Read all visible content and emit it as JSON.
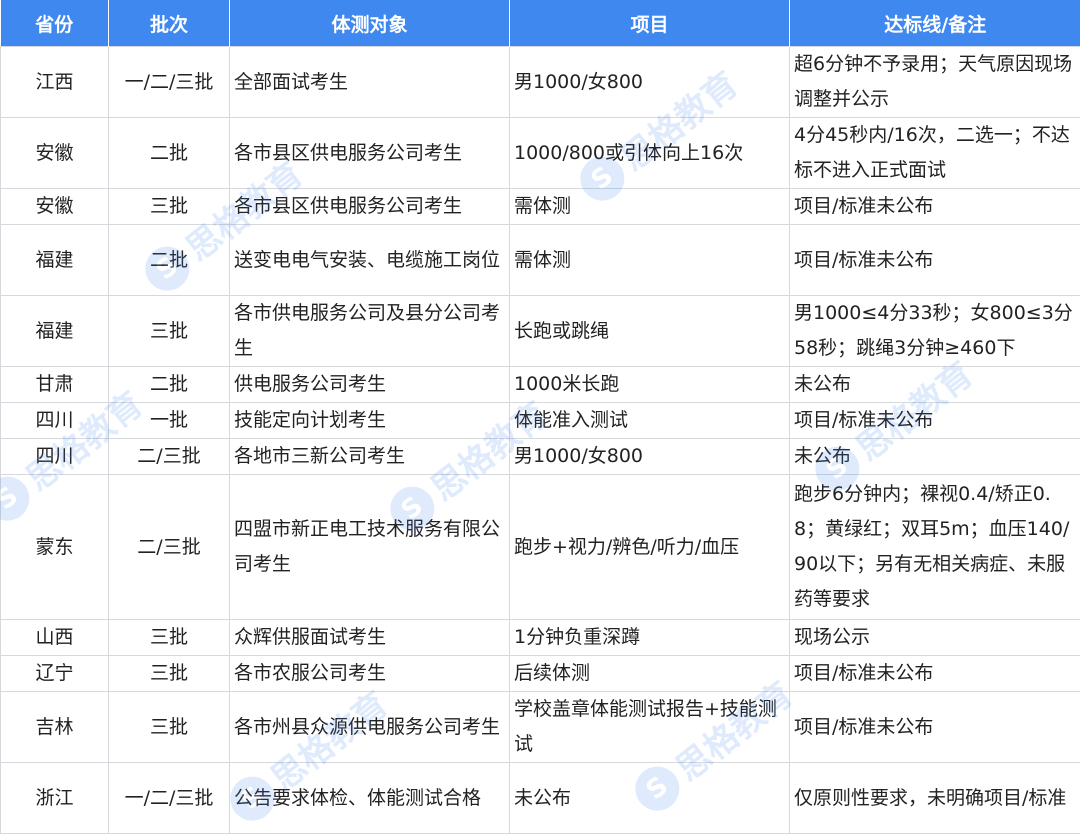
{
  "headers": [
    "省份",
    "批次",
    "体测对象",
    "项目",
    "达标线/备注"
  ],
  "rows": [
    {
      "province": "江西",
      "batch": "一/二/三批",
      "target": "全部面试考生",
      "item": "男1000/女800",
      "standard": "超6分钟不予录用；天气原因现场调整并公示"
    },
    {
      "province": "安徽",
      "batch": "二批",
      "target": "各市县区供电服务公司考生",
      "item": "1000/800或引体向上16次",
      "standard": "4分45秒内/16次，二选一；不达标不进入正式面试"
    },
    {
      "province": "安徽",
      "batch": "三批",
      "target": "各市县区供电服务公司考生",
      "item": "需体测",
      "standard": "项目/标准未公布"
    },
    {
      "province": "福建",
      "batch": "二批",
      "target": "送变电电气安装、电缆施工岗位",
      "item": "需体测",
      "standard": "项目/标准未公布"
    },
    {
      "province": "福建",
      "batch": "三批",
      "target": "各市供电服务公司及县分公司考生",
      "item": "长跑或跳绳",
      "standard": "男1000≤4分33秒；女800≤3分58秒；跳绳3分钟≥460下"
    },
    {
      "province": "甘肃",
      "batch": "二批",
      "target": "供电服务公司考生",
      "item": "1000米长跑",
      "standard": "未公布"
    },
    {
      "province": "四川",
      "batch": "一批",
      "target": "技能定向计划考生",
      "item": "体能准入测试",
      "standard": "项目/标准未公布"
    },
    {
      "province": "四川",
      "batch": "二/三批",
      "target": "各地市三新公司考生",
      "item": "男1000/女800",
      "standard": "未公布"
    },
    {
      "province": "蒙东",
      "batch": "二/三批",
      "target": "四盟市新正电工技术服务有限公司考生",
      "item": "跑步+视力/辨色/听力/血压",
      "standard": "跑步6分钟内；裸视0.4/矫正0.8；黄绿红；双耳5m；血压140/90以下；另有无相关病症、未服药等要求"
    },
    {
      "province": "山西",
      "batch": "三批",
      "target": "众辉供服面试考生",
      "item": "1分钟负重深蹲",
      "standard": "现场公示"
    },
    {
      "province": "辽宁",
      "batch": "三批",
      "target": "各市农服公司考生",
      "item": "后续体测",
      "standard": "项目/标准未公布"
    },
    {
      "province": "吉林",
      "batch": "三批",
      "target": "各市州县众源供电服务公司考生",
      "item": "学校盖章体能测试报告+技能测试",
      "standard": "项目/标准未公布"
    },
    {
      "province": "浙江",
      "batch": "一/二/三批",
      "target": "公告要求体检、体能测试合格",
      "item": "未公布",
      "standard": "仅原则性要求，未明确项目/标准"
    }
  ],
  "watermark": {
    "text": "思格教育",
    "logo": "S",
    "color": "#3f88f0"
  },
  "colors": {
    "header_bg": "#3f88f0",
    "border": "#d5d8dd"
  }
}
